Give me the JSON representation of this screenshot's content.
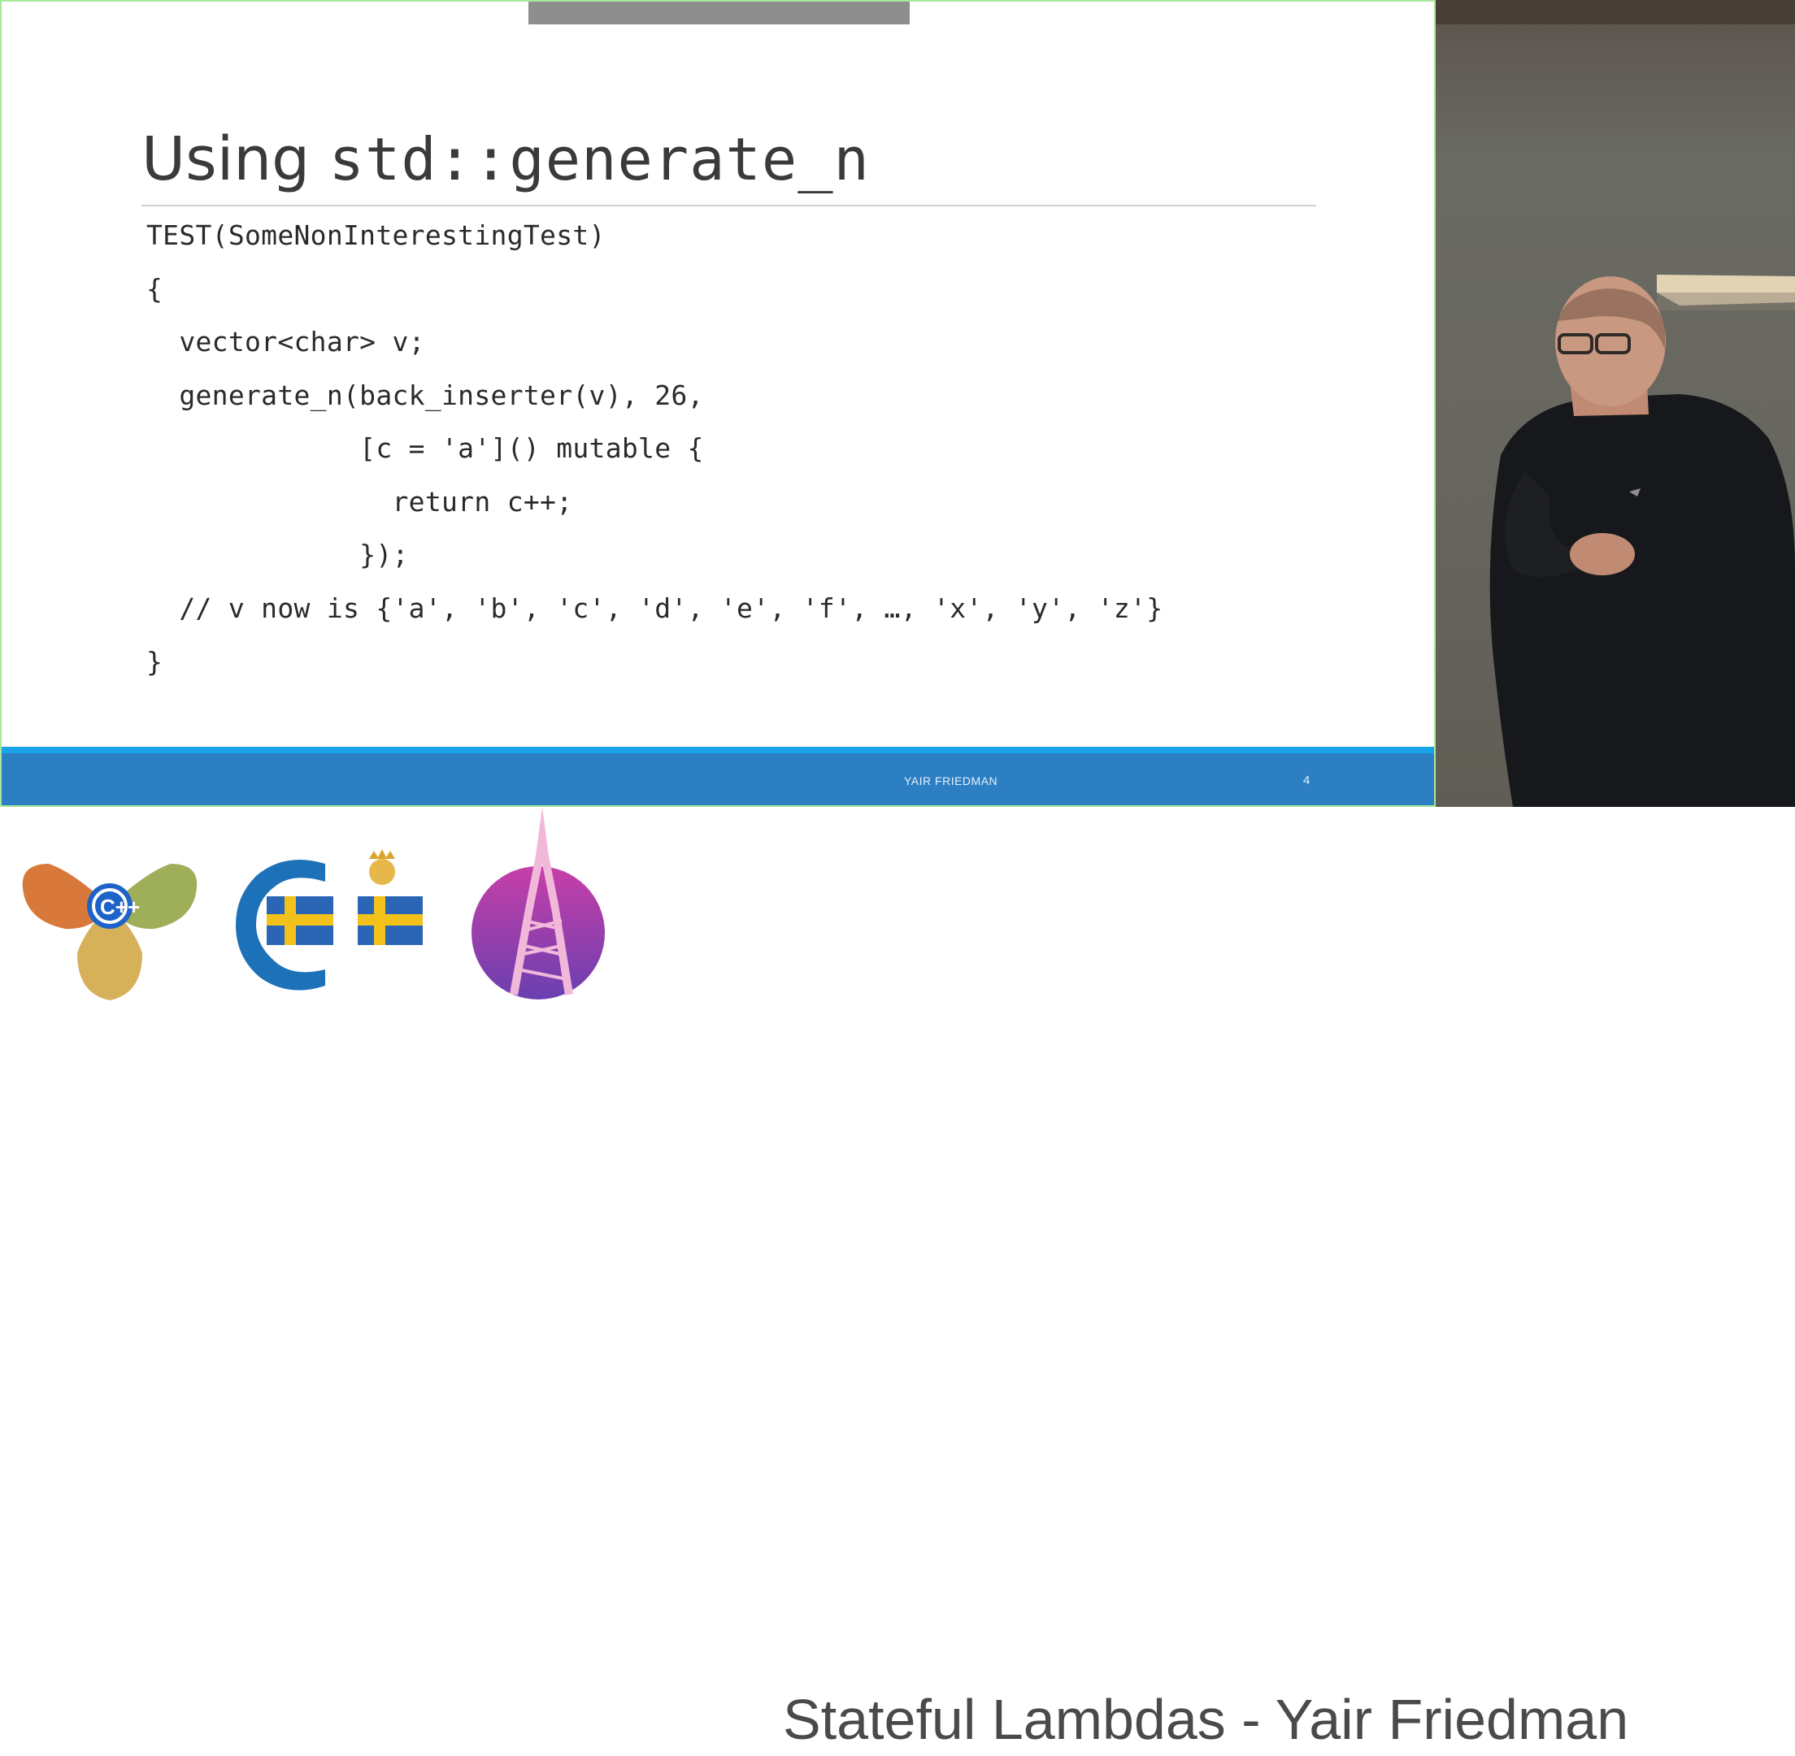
{
  "slide": {
    "title_prefix": "Using ",
    "title_code": "std::generate_n",
    "code_lines": [
      "TEST(SomeNonInterestingTest)",
      "{",
      "  vector<char> v;",
      "  generate_n(back_inserter(v), 26,",
      "             [c = 'a']() mutable {",
      "               return c++;",
      "             });",
      "  // v now is {'a', 'b', 'c', 'd', 'e', 'f', …, 'x', 'y', 'z'}",
      "}"
    ],
    "footer_author": "YAIR FRIEDMAN",
    "page_number": "4"
  },
  "banner": {
    "title": "Stateful Lambdas - Yair Friedman",
    "logo_text": "C++"
  },
  "colors": {
    "footer_blue": "#2d7fc4",
    "footer_accent": "#1aa3e6",
    "slide_border": "#a9e89a"
  },
  "icons": [
    "cpp-user-group-leaf-logo",
    "swedencpp-flag-logo",
    "stockholm-tower-logo",
    "speaker-video-feed"
  ]
}
